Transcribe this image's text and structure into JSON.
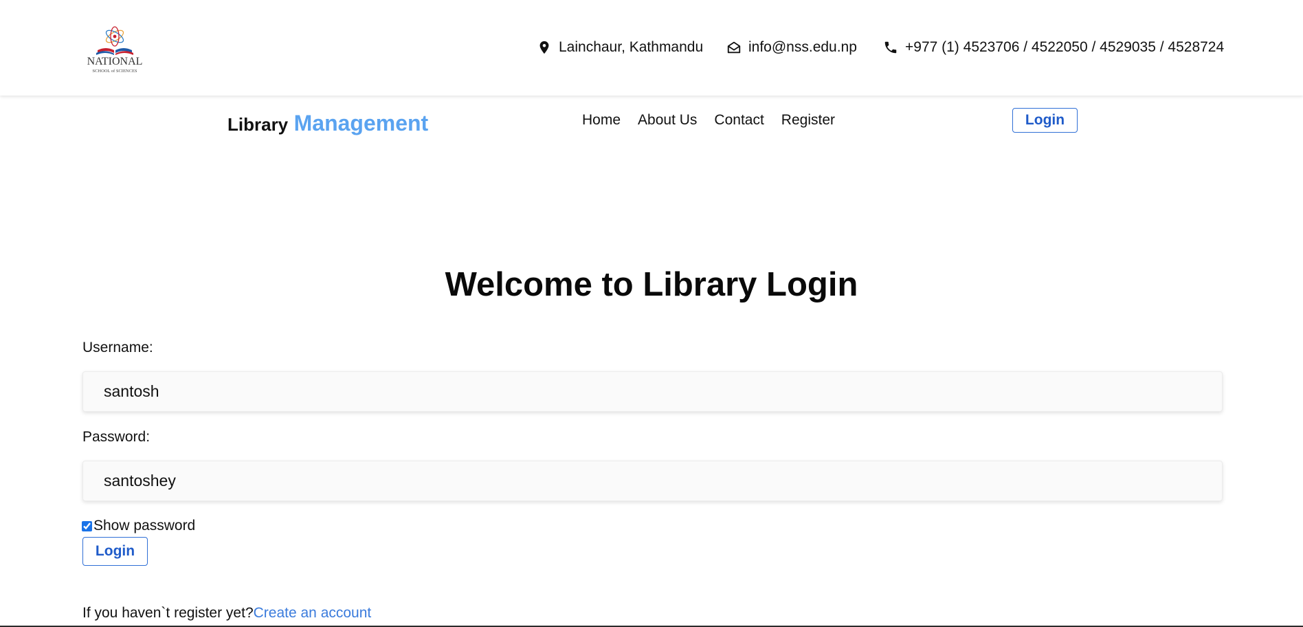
{
  "header": {
    "logo": {
      "main_text": "NATIONAL",
      "sub_text": "SCHOOL of SCIENCES"
    },
    "contacts": {
      "address": "Lainchaur, Kathmandu",
      "email": "info@nss.edu.np",
      "phone": "+977 (1) 4523706 / 4522050 / 4529035 / 4528724"
    },
    "icons": {
      "address": "map-pin-icon",
      "email": "envelope-open-icon",
      "phone": "phone-icon"
    }
  },
  "navbar": {
    "brand_part1": "Library",
    "brand_part2": "Management",
    "brand_accent_color": "#5aa3f0",
    "links": [
      "Home",
      "About Us",
      "Contact",
      "Register"
    ],
    "login_label": "Login"
  },
  "main": {
    "title": "Welcome to Library Login",
    "username_label": "Username:",
    "username_value": "santosh",
    "password_label": "Password:",
    "password_value": "santoshey",
    "show_password_label": "Show password",
    "show_password_checked": true,
    "login_label": "Login",
    "register_prompt": "If you haven`t register yet?",
    "register_link": "Create an account"
  },
  "colors": {
    "button_border": "#2f6fd6",
    "link": "#3a7bdc"
  }
}
